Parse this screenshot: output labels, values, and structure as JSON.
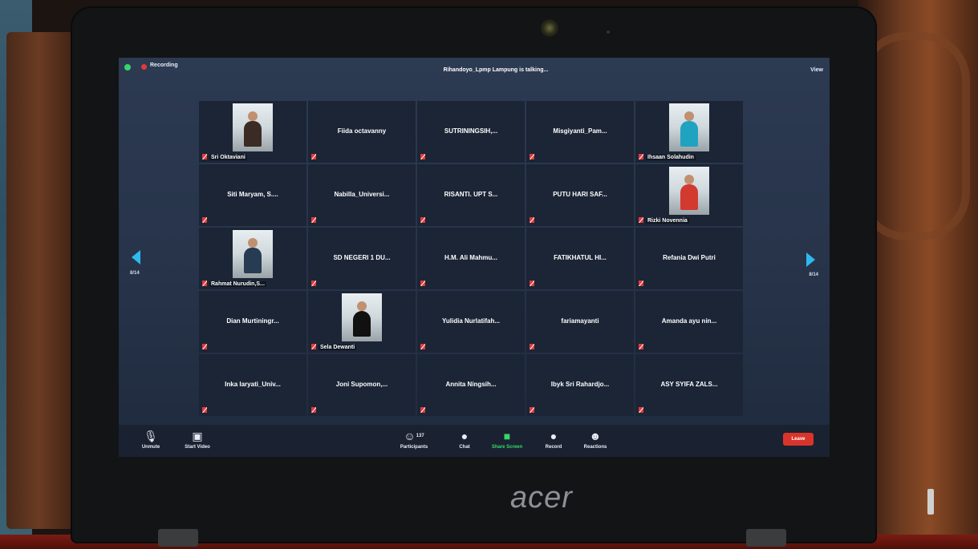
{
  "topbar": {
    "recording": "Recording",
    "talking": "Rihandoyo_Lpmp Lampung is talking...",
    "view": "View"
  },
  "page_indicator": {
    "left": "8/14",
    "right": "8/14"
  },
  "tiles": [
    {
      "name": "Sri Oktaviani",
      "video": true,
      "tone": "photo"
    },
    {
      "name": "Fiida octavanny",
      "video": false
    },
    {
      "name": "SUTRININGSIH,...",
      "video": false
    },
    {
      "name": "Misgiyanti_Pam...",
      "video": false
    },
    {
      "name": "Ihsaan Solahudin",
      "video": true,
      "tone": "cyan"
    },
    {
      "name": "Siti Maryam, S....",
      "video": false
    },
    {
      "name": "Nabilla_Universi...",
      "video": false
    },
    {
      "name": "RISANTI. UPT S...",
      "video": false
    },
    {
      "name": "PUTU HARI SAF...",
      "video": false
    },
    {
      "name": "Rizki Novennia",
      "video": true,
      "tone": "red"
    },
    {
      "name": "Rahmat Nurudin,S...",
      "video": true,
      "tone": "green"
    },
    {
      "name": "SD NEGERI 1 DU...",
      "video": false
    },
    {
      "name": "H.M. Ali Mahmu...",
      "video": false
    },
    {
      "name": "FATIKHATUL HI...",
      "video": false
    },
    {
      "name": "Refania Dwi Putri",
      "video": false
    },
    {
      "name": "Dian Murtiningr...",
      "video": false
    },
    {
      "name": "Sela Dewanti",
      "video": true,
      "tone": "teal"
    },
    {
      "name": "Yulidia Nurlatifah...",
      "video": false
    },
    {
      "name": "fariamayanti",
      "video": false
    },
    {
      "name": "Amanda ayu nin...",
      "video": false
    },
    {
      "name": "Inka Iaryati_Univ...",
      "video": false
    },
    {
      "name": "Joni Supomon,...",
      "video": false
    },
    {
      "name": "Annita Ningsih...",
      "video": false
    },
    {
      "name": "Ibyk Sri Rahardjo...",
      "video": false
    },
    {
      "name": "ASY SYIFA ZALS...",
      "video": false
    }
  ],
  "toolbar": {
    "unmute": "Unmute",
    "start_video": "Start Video",
    "participants": "Participants",
    "participant_count": "137",
    "chat": "Chat",
    "share_screen": "Share Screen",
    "record": "Record",
    "reactions": "Reactions",
    "leave": "Leave"
  },
  "device": {
    "brand": "acer"
  },
  "colors": {
    "accent": "#2fb8f0",
    "recording": "#e23a3a",
    "share_green": "#38d66a",
    "leave_red": "#d9342b"
  }
}
